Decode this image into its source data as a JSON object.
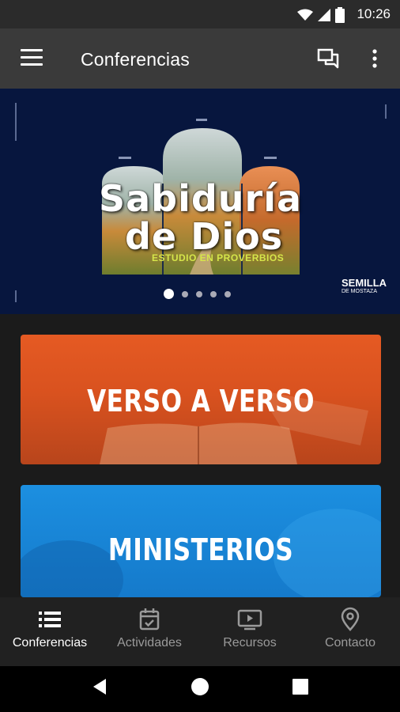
{
  "status": {
    "time": "10:26"
  },
  "appbar": {
    "title": "Conferencias"
  },
  "banner": {
    "title_line1": "Sabiduría",
    "title_line2": "de Dios",
    "subtitle": "ESTUDIO EN PROVERBIOS",
    "brand": "SEMILLA",
    "brand_sub": "DE MOSTAZA",
    "slides": 5,
    "active_slide": 1
  },
  "cards": [
    {
      "label": "VERSO A VERSO"
    },
    {
      "label": "MINISTERIOS"
    }
  ],
  "nav": [
    {
      "label": "Conferencias",
      "icon": "list-icon",
      "active": true
    },
    {
      "label": "Actividades",
      "icon": "calendar-check-icon",
      "active": false
    },
    {
      "label": "Recursos",
      "icon": "video-play-icon",
      "active": false
    },
    {
      "label": "Contacto",
      "icon": "location-pin-icon",
      "active": false
    }
  ],
  "colors": {
    "banner_bg": "#07163e",
    "card1": "#e05722",
    "card2": "#1a88d8",
    "appbar": "#3a3a3a"
  }
}
